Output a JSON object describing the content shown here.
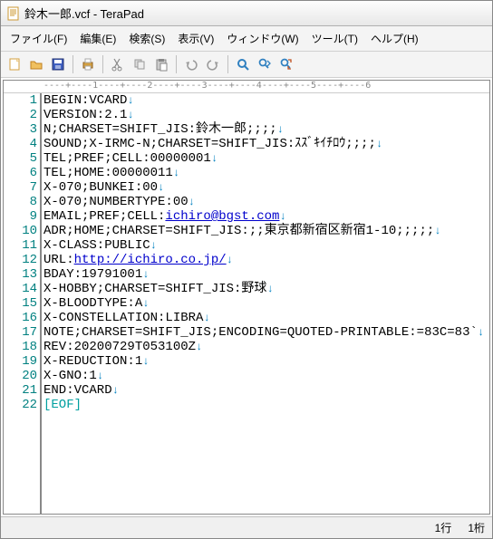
{
  "title": "鈴木一郎.vcf - TeraPad",
  "menu": {
    "file": "ファイル(F)",
    "edit": "編集(E)",
    "search": "検索(S)",
    "view": "表示(V)",
    "window": "ウィンドウ(W)",
    "tool": "ツール(T)",
    "help": "ヘルプ(H)"
  },
  "ruler": "----+----1----+----2----+----3----+----4----+----5----+----6",
  "lines": [
    {
      "segments": [
        {
          "t": "BEGIN:VCARD"
        }
      ],
      "nl": true
    },
    {
      "segments": [
        {
          "t": "VERSION:2.1"
        }
      ],
      "nl": true
    },
    {
      "segments": [
        {
          "t": "N;CHARSET=SHIFT_JIS:鈴木一郎;;;;"
        }
      ],
      "nl": true
    },
    {
      "segments": [
        {
          "t": "SOUND;X-IRMC-N;CHARSET=SHIFT_JIS:ｽｽﾞｷｲﾁﾛｳ;;;;"
        }
      ],
      "nl": true
    },
    {
      "segments": [
        {
          "t": "TEL;PREF;CELL:00000001"
        }
      ],
      "nl": true
    },
    {
      "segments": [
        {
          "t": "TEL;HOME:00000011"
        }
      ],
      "nl": true
    },
    {
      "segments": [
        {
          "t": "X-070;BUNKEI:00"
        }
      ],
      "nl": true
    },
    {
      "segments": [
        {
          "t": "X-070;NUMBERTYPE:00"
        }
      ],
      "nl": true
    },
    {
      "segments": [
        {
          "t": "EMAIL;PREF;CELL:"
        },
        {
          "t": "ichiro@bgst.com",
          "url": true
        }
      ],
      "nl": true
    },
    {
      "segments": [
        {
          "t": "ADR;HOME;CHARSET=SHIFT_JIS:;;東京都新宿区新宿1-10;;;;;"
        }
      ],
      "nl": true
    },
    {
      "segments": [
        {
          "t": "X-CLASS:PUBLIC"
        }
      ],
      "nl": true
    },
    {
      "segments": [
        {
          "t": "URL:"
        },
        {
          "t": "http://ichiro.co.jp/",
          "url": true
        }
      ],
      "nl": true
    },
    {
      "segments": [
        {
          "t": "BDAY:19791001"
        }
      ],
      "nl": true
    },
    {
      "segments": [
        {
          "t": "X-HOBBY;CHARSET=SHIFT_JIS:野球"
        }
      ],
      "nl": true
    },
    {
      "segments": [
        {
          "t": "X-BLOODTYPE:A"
        }
      ],
      "nl": true
    },
    {
      "segments": [
        {
          "t": "X-CONSTELLATION:LIBRA"
        }
      ],
      "nl": true
    },
    {
      "segments": [
        {
          "t": "NOTE;CHARSET=SHIFT_JIS;ENCODING=QUOTED-PRINTABLE:=83C=83`"
        }
      ],
      "nl": true
    },
    {
      "segments": [
        {
          "t": "REV:20200729T053100Z"
        }
      ],
      "nl": true
    },
    {
      "segments": [
        {
          "t": "X-REDUCTION:1"
        }
      ],
      "nl": true
    },
    {
      "segments": [
        {
          "t": "X-GNO:1"
        }
      ],
      "nl": true
    },
    {
      "segments": [
        {
          "t": "END:VCARD"
        }
      ],
      "nl": true
    },
    {
      "segments": [
        {
          "t": "[EOF]",
          "eof": true
        }
      ],
      "nl": false
    }
  ],
  "status": {
    "line": "1行",
    "col": "1桁"
  }
}
